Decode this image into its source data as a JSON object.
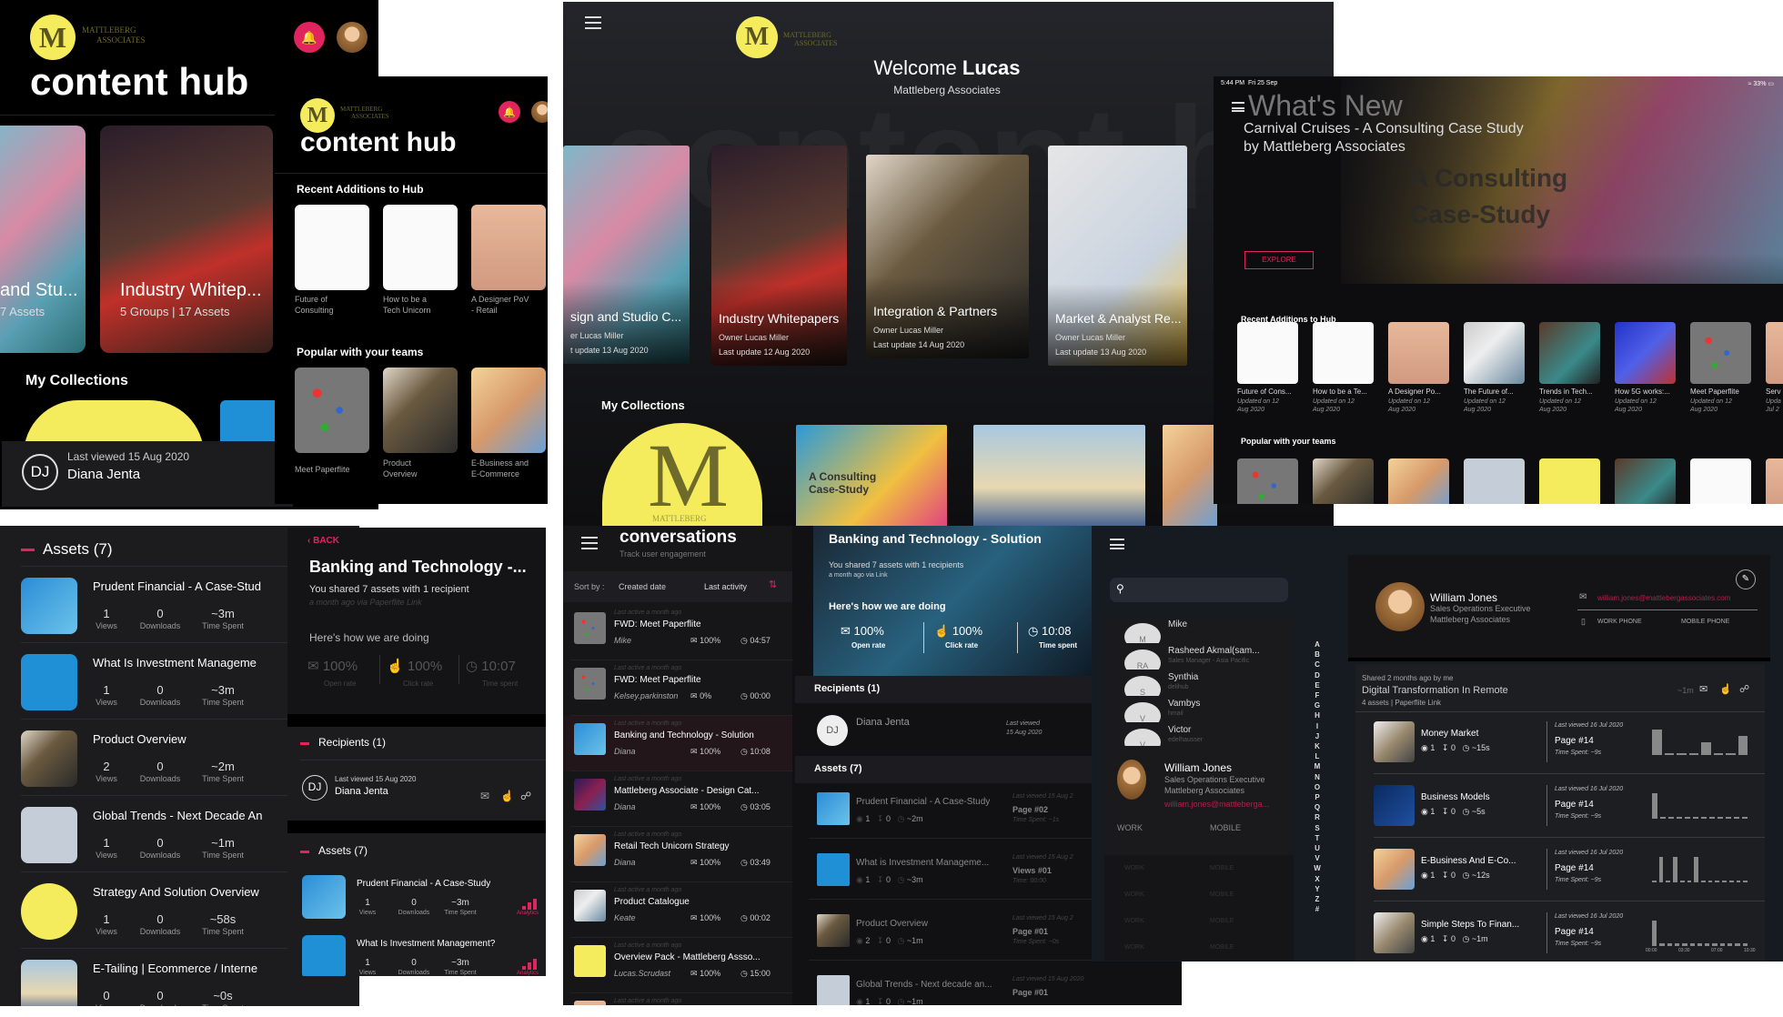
{
  "colors": {
    "accent": "#e0245e",
    "logo_yellow": "#f4ec5c",
    "panel_dark": "#1c1c1e",
    "contacts_bg": "#161a21"
  },
  "hub_phone": {
    "logo_letter": "M",
    "brand_line1": "MATTLEBERG",
    "brand_line2": "ASSOCIATES",
    "title": "content hub",
    "cards": [
      {
        "title": "and Stu...",
        "meta": "7 Assets"
      },
      {
        "title": "Industry Whitep...",
        "meta": "5 Groups | 17 Assets"
      }
    ],
    "collections_heading": "My Collections",
    "recipient": {
      "initials": "DJ",
      "last_viewed": "Last viewed 15 Aug 2020",
      "name": "Diana Jenta"
    }
  },
  "hub_phone2": {
    "logo_letter": "M",
    "brand_line1": "MATTLEBERG",
    "brand_line2": "ASSOCIATES",
    "title": "content hub",
    "recent_heading": "Recent Additions to Hub",
    "recent": [
      {
        "line1": "Future of",
        "line2": "Consulting"
      },
      {
        "line1": "How to be a",
        "line2": "Tech Unicorn"
      },
      {
        "line1": "A Designer PoV",
        "line2": "- Retail"
      }
    ],
    "popular_heading": "Popular with your teams",
    "popular": [
      {
        "line1": "Meet Paperflite",
        "line2": ""
      },
      {
        "line1": "Product",
        "line2": "Overview"
      },
      {
        "line1": "E-Business and",
        "line2": "E-Commerce"
      }
    ]
  },
  "welcome": {
    "logo_letter": "M",
    "brand_line1": "MATTLEBERG",
    "brand_line2": "ASSOCIATES",
    "greeting": "Welcome",
    "user": "Lucas",
    "org": "Mattleberg Associates",
    "collections": [
      {
        "title": "sign and Studio C...",
        "owner": "er Lucas Miller",
        "updated": "t update 13 Aug 2020"
      },
      {
        "title": "Industry Whitepapers",
        "owner": "Owner Lucas Miller",
        "updated": "Last update 12 Aug 2020"
      },
      {
        "title": "Integration & Partners",
        "owner": "Owner Lucas Miller",
        "updated": "Last update 14 Aug 2020"
      },
      {
        "title": "Market & Analyst Re...",
        "owner": "Owner Lucas Miller",
        "updated": "Last update 13 Aug 2020"
      }
    ],
    "collections_heading": "My Collections",
    "tile_text": "A Consulting Case-Study",
    "tile_brand": "MATTLEBERG"
  },
  "whats_new": {
    "status_time": "5:44 PM",
    "status_date": "Fri 25 Sep",
    "battery": "33%",
    "heading": "What's New",
    "hero_title_line1": "Carnival Cruises - A Consulting Case Study",
    "hero_title_line2": "by Mattleberg Associates",
    "hero_overlay_line1": "A Consulting",
    "hero_overlay_line2": "Case-Study",
    "explore": "EXPLORE",
    "recent_heading": "Recent Additions to Hub",
    "recent": [
      {
        "title": "Future of Cons...",
        "updated1": "Updated on 12",
        "updated2": "Aug 2020"
      },
      {
        "title": "How to be a Te...",
        "updated1": "Updated on 12",
        "updated2": "Aug 2020"
      },
      {
        "title": "A Designer Po...",
        "updated1": "Updated on 12",
        "updated2": "Aug 2020"
      },
      {
        "title": "The Future of...",
        "updated1": "Updated on 12",
        "updated2": "Aug 2020"
      },
      {
        "title": "Trends in Tech...",
        "updated1": "Updated on 12",
        "updated2": "Aug 2020"
      },
      {
        "title": "How 5G works:...",
        "updated1": "Updated on 12",
        "updated2": "Aug 2020"
      },
      {
        "title": "Meet Paperflite",
        "updated1": "Updated on 12",
        "updated2": "Aug 2020"
      },
      {
        "title": "Serv",
        "updated1": "Upda",
        "updated2": "Jul 2"
      }
    ],
    "popular_heading": "Popular with your teams"
  },
  "assets_phone": {
    "heading": "Assets (7)",
    "stat_labels": {
      "views": "Views",
      "downloads": "Downloads",
      "time": "Time Spent"
    },
    "items": [
      {
        "title": "Prudent Financial - A Case-Stud",
        "views": "1",
        "downloads": "0",
        "time": "~3m"
      },
      {
        "title": "What Is Investment Manageme",
        "views": "1",
        "downloads": "0",
        "time": "~3m"
      },
      {
        "title": "Product Overview",
        "views": "2",
        "downloads": "0",
        "time": "~2m"
      },
      {
        "title": "Global Trends - Next Decade An",
        "views": "1",
        "downloads": "0",
        "time": "~1m"
      },
      {
        "title": "Strategy And Solution Overview",
        "views": "1",
        "downloads": "0",
        "time": "~58s"
      },
      {
        "title": "E-Tailing | Ecommerce / Interne",
        "views": "0",
        "downloads": "0",
        "time": "~0s"
      }
    ]
  },
  "conversation_phone": {
    "back": "BACK",
    "title": "Banking and Technology -...",
    "shared": "You shared 7 assets with 1 recipient",
    "shared_meta": "a month ago via Paperflite Link",
    "doing": "Here's how we are doing",
    "stats": [
      {
        "value": "100%",
        "label": "Open rate"
      },
      {
        "value": "100%",
        "label": "Click rate"
      },
      {
        "value": "10:07",
        "label": "Time spent"
      }
    ],
    "recipients_heading": "Recipients (1)",
    "recipient": {
      "initials": "DJ",
      "last_viewed": "Last viewed 15 Aug 2020",
      "name": "Diana Jenta"
    },
    "assets_heading": "Assets (7)",
    "stat_labels": {
      "views": "Views",
      "downloads": "Downloads",
      "time": "Time Spent"
    },
    "analytics_label": "Analytics",
    "items": [
      {
        "title": "Prudent Financial - A Case-Study",
        "views": "1",
        "downloads": "0",
        "time": "~3m"
      },
      {
        "title": "What Is Investment Management?",
        "views": "1",
        "downloads": "0",
        "time": "~3m"
      }
    ]
  },
  "conversations": {
    "title": "conversations",
    "subtitle": "Track user engagement",
    "sort_label": "Sort by :",
    "sort_created": "Created date",
    "sort_activity": "Last activity",
    "list": [
      {
        "active": "Last active a month ago",
        "title": "FWD: Meet Paperflite",
        "who": "Mike",
        "open": "100%",
        "time": "04:57"
      },
      {
        "active": "Last active a month ago",
        "title": "FWD: Meet Paperflite",
        "who": "Kelsey.parkinston",
        "open": "0%",
        "time": "00:00"
      },
      {
        "active": "Last active a month ago",
        "title": "Banking and Technology - Solution",
        "who": "Diana",
        "open": "100%",
        "time": "10:08",
        "selected": true
      },
      {
        "active": "Last active a month ago",
        "title": "Mattleberg Associate - Design Cat...",
        "who": "Diana",
        "open": "100%",
        "time": "03:05"
      },
      {
        "active": "Last active a month ago",
        "title": "Retail Tech Unicorn Strategy",
        "who": "Diana",
        "open": "100%",
        "time": "03:49"
      },
      {
        "active": "Last active a month ago",
        "title": "Product Catalogue",
        "who": "Keate",
        "open": "100%",
        "time": "00:02"
      },
      {
        "active": "Last active a month ago",
        "title": "Overview Pack - Mattleberg Assso...",
        "who": "Lucas.Scrudast",
        "open": "100%",
        "time": "15:00"
      },
      {
        "active": "Last active a month ago",
        "title": "",
        "who": "",
        "open": "",
        "time": ""
      }
    ],
    "detail": {
      "title": "Banking and Technology - Solution",
      "shared": "You shared 7 assets with 1 recipients",
      "shared_meta": "a month ago via Link",
      "doing": "Here's how we are doing",
      "stats": [
        {
          "value": "100%",
          "label": "Open rate"
        },
        {
          "value": "100%",
          "label": "Click rate"
        },
        {
          "value": "10:08",
          "label": "Time spent"
        }
      ],
      "recipients_heading": "Recipients (1)",
      "recipient": {
        "initials": "DJ",
        "name": "Diana Jenta",
        "last_viewed_1": "Last viewed",
        "last_viewed_2": "15 Aug 2020"
      },
      "assets_heading": "Assets (7)",
      "assets": [
        {
          "title": "Prudent Financial - A Case-Study",
          "views": "1",
          "downloads": "0",
          "time": "~2m",
          "last": "Last viewed 15 Aug 2",
          "page": "Page #02",
          "spent": "Time Spent: ~1s"
        },
        {
          "title": "What is Investment Manageme...",
          "views": "1",
          "downloads": "0",
          "time": "~3m",
          "last": "Last viewed 15 Aug 2",
          "page": "Views #01",
          "spent": "Time: 00:00"
        },
        {
          "title": "Product Overview",
          "views": "2",
          "downloads": "0",
          "time": "~1m",
          "last": "Last viewed 15 Aug 2",
          "page": "Page #01",
          "spent": "Time Spent: ~0s"
        },
        {
          "title": "Global Trends - Next decade an...",
          "views": "1",
          "downloads": "0",
          "time": "~1m",
          "last": "Last viewed 15 Aug 2020",
          "page": "Page #01",
          "spent": ""
        }
      ]
    }
  },
  "contacts": {
    "search_placeholder": "",
    "list": [
      {
        "name": "Mike",
        "sub": "",
        "initials": "M"
      },
      {
        "name": "Rasheed Akmal(sam...",
        "sub": "Sales Manager - Asia Pacific",
        "initials": "RA"
      },
      {
        "name": "Synthia",
        "sub": "delihub",
        "initials": "S"
      },
      {
        "name": "Vambys",
        "sub": "hmail",
        "initials": "V"
      },
      {
        "name": "Victor",
        "sub": "edelhausser",
        "initials": "V"
      }
    ],
    "selected": {
      "name": "William Jones",
      "title": "Sales Operations Executive",
      "company": "Mattleberg Associates",
      "email": "william.jones@mattleberga...",
      "work": "WORK",
      "mobile": "MOBILE"
    },
    "faded_rows": [
      {
        "work": "WORK",
        "mobile": "MOBILE"
      },
      {
        "work": "WORK",
        "mobile": "MOBILE"
      },
      {
        "work": "WORK",
        "mobile": "MOBILE"
      },
      {
        "work": "WORK",
        "mobile": "MOBILE"
      }
    ],
    "alphabet": [
      "A",
      "B",
      "C",
      "D",
      "E",
      "F",
      "G",
      "H",
      "I",
      "J",
      "K",
      "L",
      "M",
      "N",
      "O",
      "P",
      "Q",
      "R",
      "S",
      "T",
      "U",
      "V",
      "W",
      "X",
      "Y",
      "Z",
      "#"
    ],
    "profile": {
      "name": "William Jones",
      "title": "Sales Operations Executive",
      "company": "Mattleberg Associates",
      "email": "william.jones@mattlebergassociates.com",
      "work_phone": "WORK PHONE",
      "mobile_phone": "MOBILE PHONE"
    },
    "share": {
      "shared": "Shared 2 months ago by me",
      "title": "Digital Transformation In Remote",
      "meta": "4 assets | Paperflite Link",
      "time": "~1m"
    },
    "assets": [
      {
        "title": "Money Market",
        "views": "1",
        "downloads": "0",
        "time": "~15s",
        "last": "Last viewed 16 Jul 2020",
        "page": "Page #14",
        "spent": "Time Spent: ~9s",
        "activity": [
          8,
          0,
          0,
          0,
          4,
          0,
          0,
          6
        ]
      },
      {
        "title": "Business Models",
        "views": "1",
        "downloads": "0",
        "time": "~5s",
        "last": "Last viewed 16 Jul 2020",
        "page": "Page #14",
        "spent": "Time Spent: ~9s",
        "activity": [
          8,
          0,
          0,
          0,
          0,
          0,
          0,
          0,
          0,
          0,
          0,
          0
        ]
      },
      {
        "title": "E-Business And E-Co...",
        "views": "1",
        "downloads": "0",
        "time": "~12s",
        "last": "Last viewed 16 Jul 2020",
        "page": "Page #14",
        "spent": "Time Spent: ~9s",
        "activity": [
          0,
          8,
          0,
          8,
          0,
          0,
          8,
          0,
          0,
          0,
          0,
          0,
          0,
          0
        ]
      },
      {
        "title": "Simple Steps To Finan...",
        "views": "1",
        "downloads": "0",
        "time": "~1m",
        "last": "Last viewed 16 Jul 2020",
        "page": "Page #14",
        "spent": "Time Spent: ~9s",
        "activity": [
          8,
          1,
          1,
          1,
          1,
          1,
          1,
          1,
          1,
          1,
          1,
          1,
          1
        ],
        "axis": [
          "00:00",
          "03:30",
          "07:00",
          "10:30"
        ]
      }
    ]
  }
}
